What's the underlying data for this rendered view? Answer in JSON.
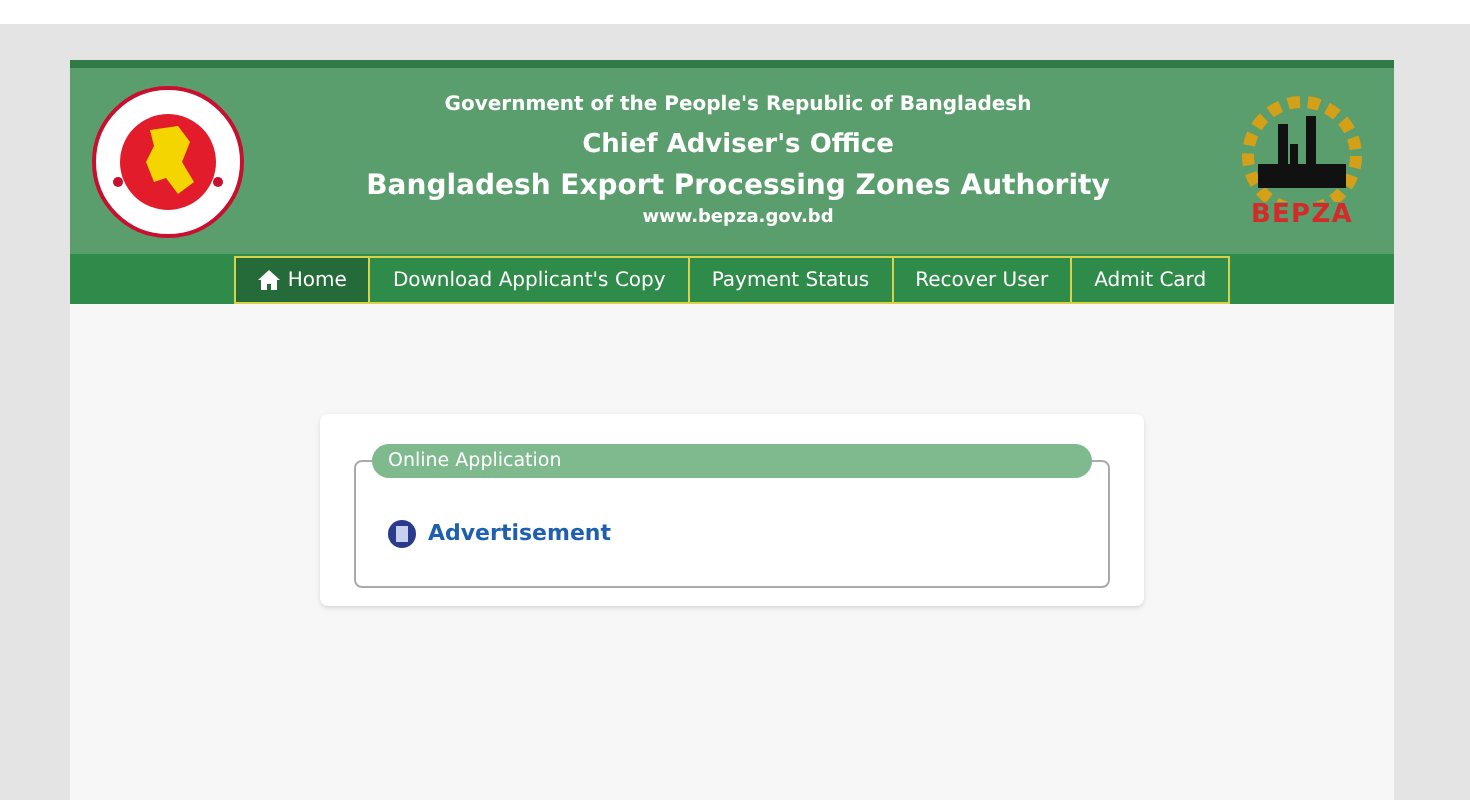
{
  "header": {
    "line_1": "Government of the People's Republic of Bangladesh",
    "line_2": "Chief Adviser's Office",
    "line_3": "Bangladesh Export Processing Zones Authority",
    "website": "www.bepza.gov.bd",
    "logo_text": "BEPZA"
  },
  "nav": [
    {
      "label": "Home",
      "kind": "home",
      "selected": true
    },
    {
      "label": "Download Applicant's Copy",
      "kind": "link",
      "selected": false
    },
    {
      "label": "Payment Status",
      "kind": "link",
      "selected": false
    },
    {
      "label": "Recover User",
      "kind": "link",
      "selected": false
    },
    {
      "label": "Admit Card",
      "kind": "link",
      "selected": false
    }
  ],
  "panel": {
    "legend": "Online Application",
    "links": [
      {
        "label": "Advertisement"
      }
    ]
  }
}
